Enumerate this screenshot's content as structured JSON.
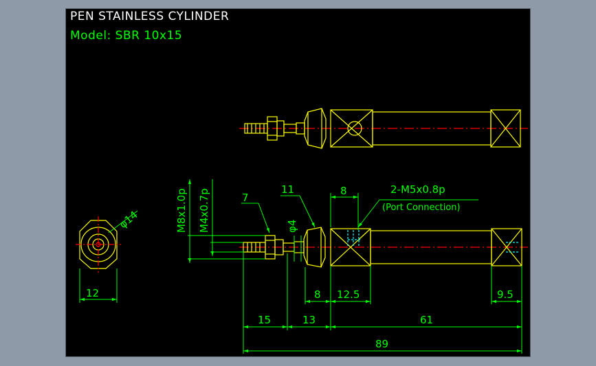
{
  "drawing": {
    "title": "PEN STAINLESS CYLINDER",
    "model": "Model: SBR 10x15",
    "colors": {
      "background": "#000000",
      "outline": "#ffff00",
      "dimension": "#00ff00",
      "centerline": "#ff0000",
      "hidden": "#00ffff",
      "title": "#ffffff",
      "frame": "#8f9aa8"
    }
  },
  "dimensions": {
    "thread_main": "M8x1.0p",
    "thread_rod": "M4x0.7p",
    "rod_dia": "φ4",
    "body_dia": "φ14",
    "nut_width": "7",
    "body_nut": "11",
    "port_offset": "8",
    "port_spec": "2-M5x0.8p",
    "port_note": "(Port Connection)",
    "end_width": "12",
    "nut_length": "8",
    "port_length": "12.5",
    "cap_length": "9.5",
    "rod_length": "15",
    "neck_length": "13",
    "body_length": "61",
    "total_length": "89"
  }
}
